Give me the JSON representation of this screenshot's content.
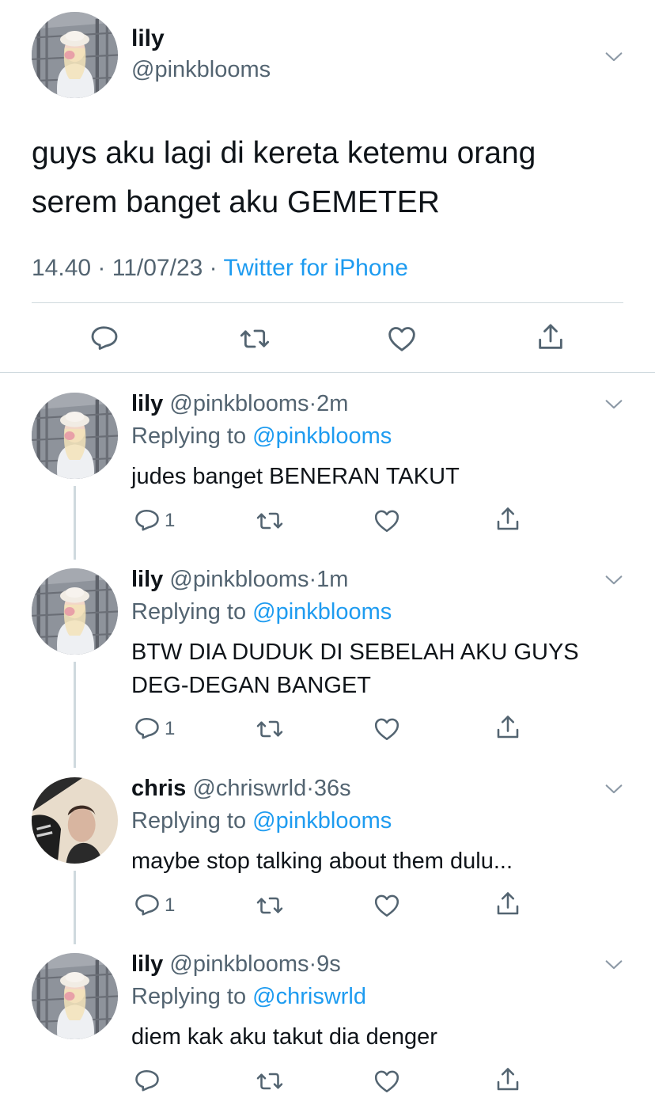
{
  "main_tweet": {
    "name": "lily",
    "handle": "@pinkblooms",
    "text_line1": "guys aku lagi di kereta ketemu orang",
    "text_line2": "serem banget aku GEMETER",
    "time": "14.40",
    "date": "11/07/23",
    "source": "Twitter for iPhone",
    "sep": "·"
  },
  "replies": [
    {
      "name": "lily",
      "handle": "@pinkblooms",
      "time": "2m",
      "replying_prefix": "Replying to",
      "replying_to": "@pinkblooms",
      "text": "judes banget BENERAN TAKUT",
      "reply_count": "1"
    },
    {
      "name": "lily",
      "handle": "@pinkblooms",
      "time": "1m",
      "replying_prefix": "Replying to",
      "replying_to": "@pinkblooms",
      "text_line1": "BTW DIA DUDUK DI SEBELAH AKU GUYS",
      "text_line2": "DEG-DEGAN BANGET",
      "reply_count": "1"
    },
    {
      "name": "chris",
      "handle": "@chriswrld",
      "time": "36s",
      "replying_prefix": "Replying to",
      "replying_to": "@pinkblooms",
      "text": "maybe stop talking about them dulu...",
      "reply_count": "1"
    },
    {
      "name": "lily",
      "handle": "@pinkblooms",
      "time": "9s",
      "replying_prefix": "Replying to",
      "replying_to": "@chriswrld",
      "text": "diem kak aku takut dia denger",
      "reply_count": ""
    }
  ],
  "colors": {
    "accent": "#1d9bf0",
    "secondary_text": "#536471",
    "divider": "#cfd9de"
  },
  "icons": [
    "chevron-down-icon",
    "reply-icon",
    "retweet-icon",
    "like-icon",
    "share-icon"
  ]
}
